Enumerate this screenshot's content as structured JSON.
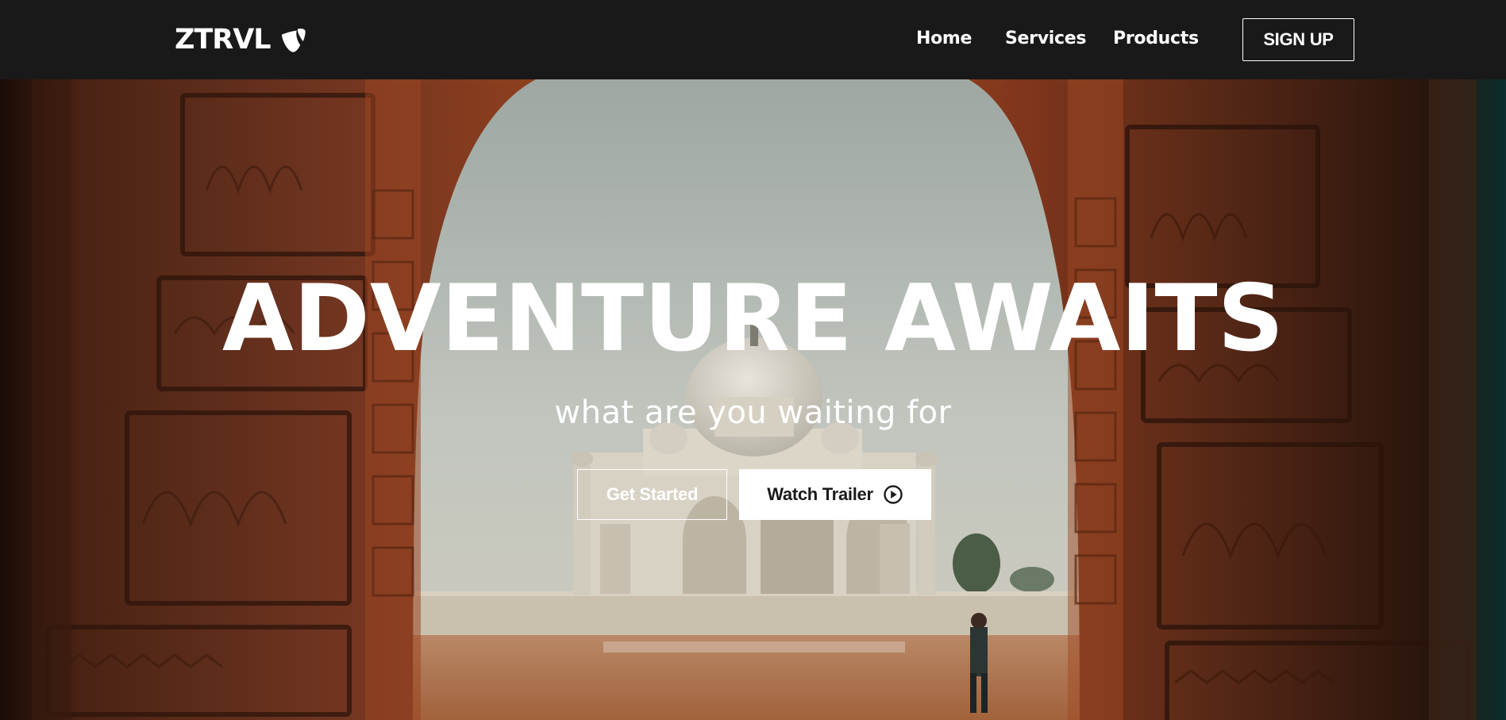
{
  "navbar": {
    "brand": "ZTRVL",
    "brand_icon": "typo3-logo-icon",
    "links": [
      "Home",
      "Services",
      "Products"
    ],
    "signup_label": "SIGN UP"
  },
  "hero": {
    "title": "ADVENTURE AWAITS",
    "subtitle": "what are you waiting for",
    "primary_button": "Get Started",
    "secondary_button": "Watch Trailer",
    "secondary_icon": "play-circle-icon",
    "background": "taj-mahal-through-arch-photo"
  },
  "colors": {
    "navbar_bg": "#1a1919",
    "text": "#ffffff",
    "button_fill": "#ffffff",
    "button_text": "#1a1a1a"
  }
}
